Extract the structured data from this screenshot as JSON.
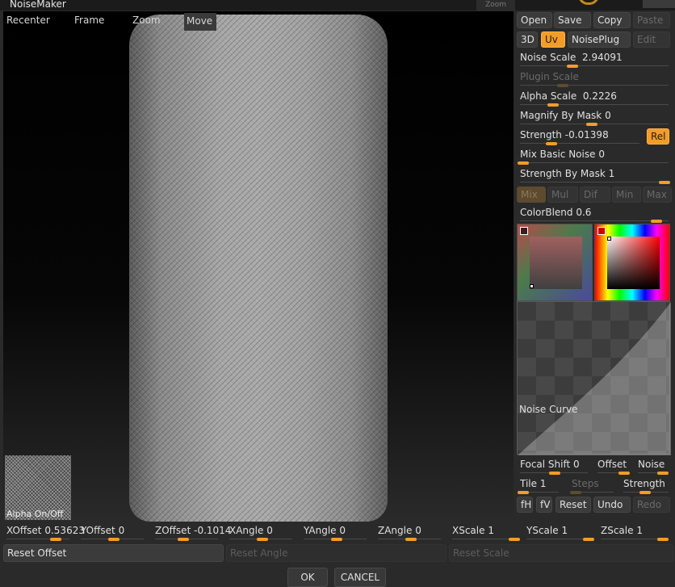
{
  "window": {
    "title": "NoiseMaker",
    "zoom_tab": "Zoom"
  },
  "viewport": {
    "toolbar": {
      "recenter": "Recenter",
      "frame": "Frame",
      "zoom": "Zoom",
      "move": "Move"
    },
    "alpha_toggle": "Alpha On/Off"
  },
  "panel": {
    "row1": {
      "open": "Open",
      "save": "Save",
      "copy": "Copy",
      "paste": "Paste"
    },
    "row2": {
      "mode_3d": "3D",
      "uv": "Uv",
      "noiseplug": "NoisePlug",
      "edit": "Edit"
    },
    "sliders": {
      "noise_scale": {
        "label": "Noise Scale",
        "value": "2.94091"
      },
      "plugin_scale": {
        "label": "Plugin Scale",
        "value": ""
      },
      "alpha_scale": {
        "label": "Alpha Scale",
        "value": "0.2226"
      },
      "magnify_by_mask": {
        "label": "Magnify By Mask",
        "value": "0"
      },
      "strength": {
        "label": "Strength",
        "value": "-0.01398"
      },
      "mix_basic_noise": {
        "label": "Mix Basic Noise",
        "value": "0"
      },
      "strength_by_mask": {
        "label": "Strength By Mask",
        "value": "1"
      },
      "color_blend": {
        "label": "ColorBlend",
        "value": "0.6"
      }
    },
    "rel": "Rel",
    "blend_modes": [
      "Mix",
      "Mul",
      "Dif",
      "Min",
      "Max"
    ],
    "noise_curve": {
      "label": "Noise Curve"
    },
    "curve_controls": {
      "focal_shift": {
        "label": "Focal Shift",
        "value": "0"
      },
      "offset": "Offset",
      "noise": "Noise",
      "tile": {
        "label": "Tile",
        "value": "1"
      },
      "steps": "Steps",
      "strength": "Strength"
    },
    "curve_buttons": {
      "fh": "fH",
      "fv": "fV",
      "reset": "Reset",
      "undo": "Undo",
      "redo": "Redo"
    }
  },
  "transform": {
    "xoffset": {
      "label": "XOffset",
      "value": "0.53623"
    },
    "yoffset": {
      "label": "YOffset",
      "value": "0"
    },
    "zoffset": {
      "label": "ZOffset",
      "value": "-0.1014"
    },
    "xangle": {
      "label": "XAngle",
      "value": "0"
    },
    "yangle": {
      "label": "YAngle",
      "value": "0"
    },
    "zangle": {
      "label": "ZAngle",
      "value": "0"
    },
    "xscale": {
      "label": "XScale",
      "value": "1"
    },
    "yscale": {
      "label": "YScale",
      "value": "1"
    },
    "zscale": {
      "label": "ZScale",
      "value": "1"
    }
  },
  "reset_buttons": {
    "offset": "Reset Offset",
    "angle": "Reset Angle",
    "scale": "Reset Scale"
  },
  "footer": {
    "ok": "OK",
    "cancel": "CANCEL"
  },
  "colors": {
    "accent": "#f39c27",
    "bg": "#2a2a2a",
    "button": "#3b3b3b"
  }
}
